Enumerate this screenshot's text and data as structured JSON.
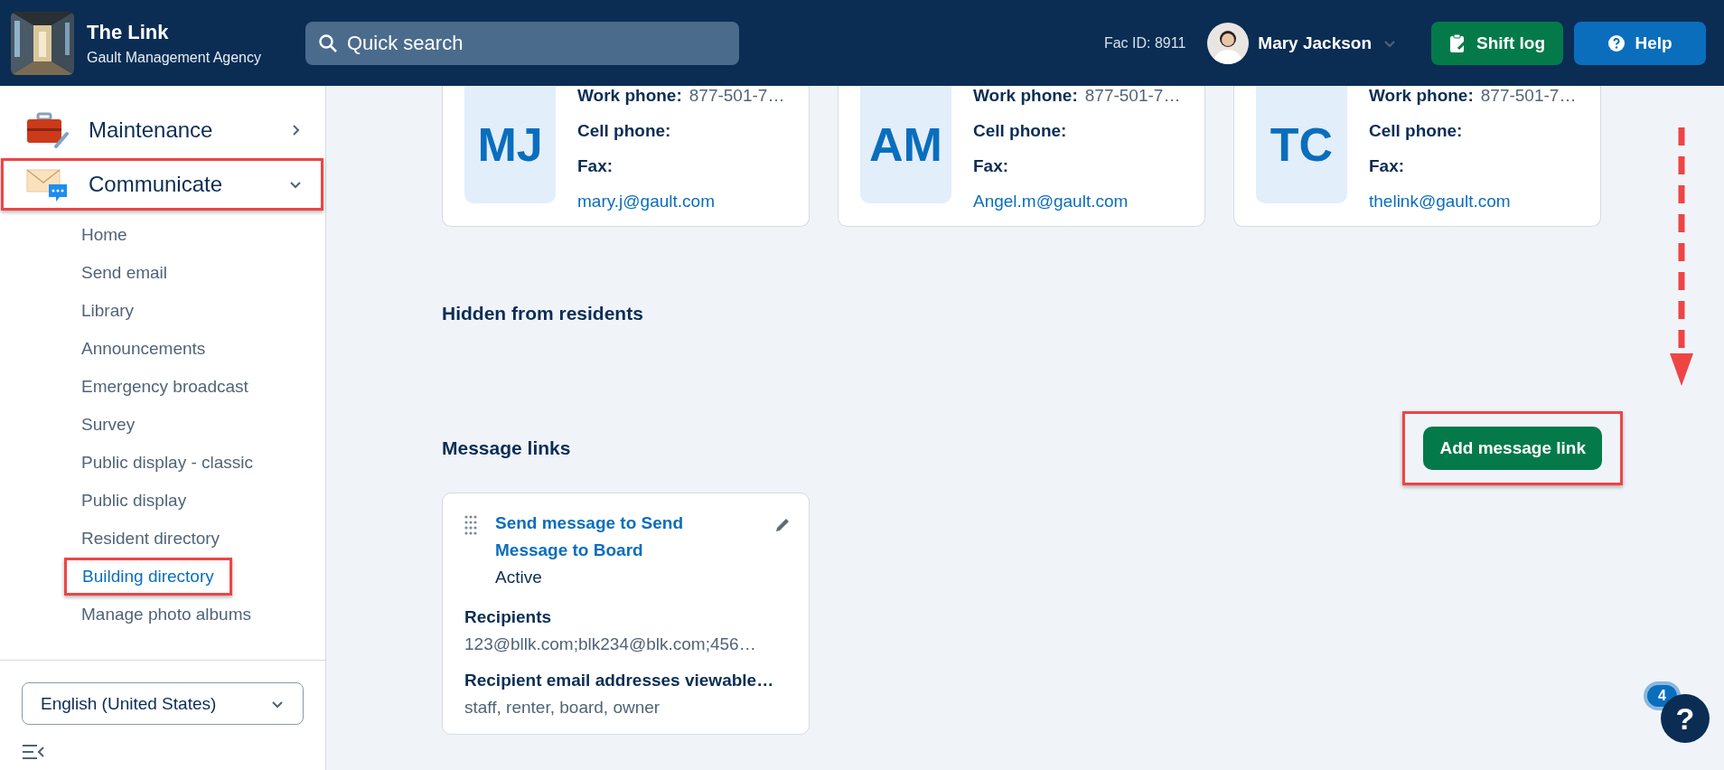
{
  "header": {
    "app_title": "The Link",
    "app_subtitle": "Gault Management Agency",
    "search_placeholder": "Quick search",
    "fac_id": "Fac ID: 8911",
    "user_name": "Mary Jackson",
    "buttons": [
      {
        "kind": "shift",
        "label": "Shift log"
      },
      {
        "kind": "help",
        "label": "Help"
      }
    ]
  },
  "sidebar": {
    "groups": [
      {
        "kind": "maintenance",
        "label": "Maintenance",
        "expanded": false,
        "annotated": false
      },
      {
        "kind": "communicate",
        "label": "Communicate",
        "expanded": true,
        "annotated": true,
        "items": [
          {
            "label": "Home",
            "selected": false,
            "annotated": false
          },
          {
            "label": "Send email",
            "selected": false,
            "annotated": false
          },
          {
            "label": "Library",
            "selected": false,
            "annotated": false
          },
          {
            "label": "Announcements",
            "selected": false,
            "annotated": false
          },
          {
            "label": "Emergency broadcast",
            "selected": false,
            "annotated": false
          },
          {
            "label": "Survey",
            "selected": false,
            "annotated": false
          },
          {
            "label": "Public display - classic",
            "selected": false,
            "annotated": false
          },
          {
            "label": "Public display",
            "selected": false,
            "annotated": false
          },
          {
            "label": "Resident directory",
            "selected": false,
            "annotated": false
          },
          {
            "label": "Building directory",
            "selected": true,
            "annotated": true
          },
          {
            "label": "Manage photo albums",
            "selected": false,
            "annotated": false
          }
        ]
      }
    ],
    "language": "English (United States)"
  },
  "contacts": [
    {
      "initials": "MJ",
      "work_phone_label": "Work phone:",
      "work_phone": "877-501-7…",
      "cell_label": "Cell phone:",
      "fax_label": "Fax:",
      "email": "mary.j@gault.com"
    },
    {
      "initials": "AM",
      "work_phone_label": "Work phone:",
      "work_phone": "877-501-7…",
      "cell_label": "Cell phone:",
      "fax_label": "Fax:",
      "email": "Angel.m@gault.com"
    },
    {
      "initials": "TC",
      "work_phone_label": "Work phone:",
      "work_phone": "877-501-7…",
      "cell_label": "Cell phone:",
      "fax_label": "Fax:",
      "email": "thelink@gault.com"
    }
  ],
  "hidden_heading": "Hidden from residents",
  "message_links": {
    "heading": "Message links",
    "add_button": {
      "label": "Add message link",
      "annotated": true
    },
    "cards": [
      {
        "title": "Send message to Send Message to Board",
        "status": "Active",
        "recipients_label": "Recipients",
        "recipients": "123@bllk.com;blk234@blk.com;456…",
        "viewable_label": "Recipient email addresses viewable…",
        "viewable": "staff, renter, board, owner"
      }
    ]
  },
  "help_fab": {
    "badge": "4",
    "label": "?"
  }
}
